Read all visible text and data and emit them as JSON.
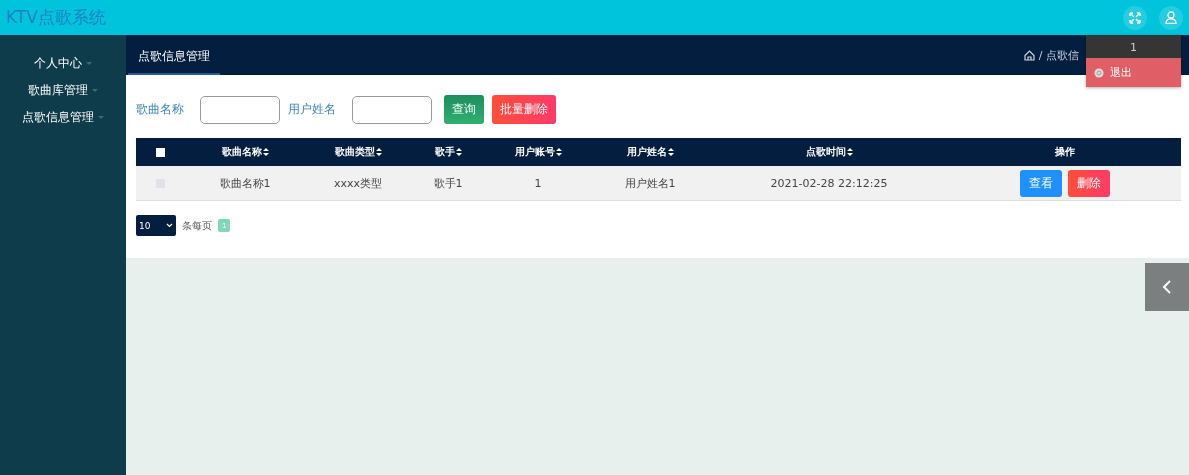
{
  "header": {
    "title": "KTV点歌系统"
  },
  "sidebar": {
    "items": [
      {
        "label": "个人中心"
      },
      {
        "label": "歌曲库管理"
      },
      {
        "label": "点歌信息管理"
      }
    ]
  },
  "tabs": [
    {
      "label": "点歌信息管理",
      "selected": true
    }
  ],
  "breadcrumb": {
    "text": "/ 点歌信"
  },
  "user_menu": {
    "username": "1",
    "items": [
      {
        "label": "退出",
        "selected": true
      }
    ]
  },
  "search": {
    "fields": [
      {
        "label": "歌曲名称"
      },
      {
        "label": "用户姓名"
      }
    ],
    "buttons": [
      {
        "label": "查询",
        "kind": "query"
      },
      {
        "label": "批量删除",
        "kind": "danger"
      }
    ]
  },
  "table": {
    "columns": [
      {
        "label": "歌曲名称",
        "sortable": true
      },
      {
        "label": "歌曲类型",
        "sortable": true
      },
      {
        "label": "歌手",
        "sortable": true
      },
      {
        "label": "用户账号",
        "sortable": true
      },
      {
        "label": "用户姓名",
        "sortable": true
      },
      {
        "label": "点歌时间",
        "sortable": true
      },
      {
        "label": "操作",
        "sortable": false
      }
    ],
    "header_checked": false,
    "rows": [
      {
        "checked": false,
        "cells": [
          "歌曲名称1",
          "xxxx类型",
          "歌手1",
          "1",
          "用户姓名1",
          "2021-02-28 22:12:25"
        ],
        "actions": [
          {
            "label": "查看",
            "kind": "view"
          },
          {
            "label": "删除",
            "kind": "delete"
          }
        ]
      }
    ]
  },
  "pagination": {
    "page_size": "10",
    "page_size_label": "条每页",
    "pages": [
      {
        "label": "1",
        "selected": true
      }
    ]
  }
}
